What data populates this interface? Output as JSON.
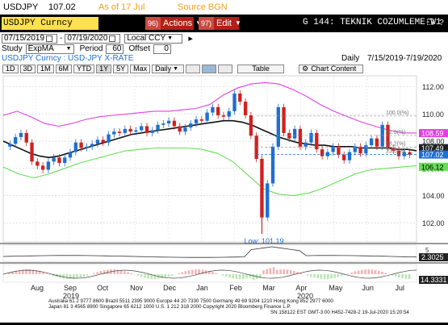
{
  "header": {
    "ticker": "USDJPY",
    "price": "107.02",
    "as_of": "As of 17 Jul",
    "source": "Source BGN"
  },
  "command_bar": {
    "security": "USDJPY Curncy",
    "actions_num": "96)",
    "actions_label": "Actions",
    "edit_num": "97)",
    "edit_label": "Edit",
    "function_title": "G 144: TEKNIK COZUMLEME-W1"
  },
  "controls": {
    "start_date": "07/15/2019",
    "end_date": "07/19/2020",
    "currency": "Local CCY",
    "study_label": "Study",
    "study_value": "ExpMA",
    "period_label": "Period",
    "period_value": "60",
    "offset_label": "Offset",
    "offset_value": "0",
    "subtitle": "USDJPY Curncy : USD-JPY X-RATE",
    "frequency": "Daily",
    "date_range": "7/15/2019-7/19/2020"
  },
  "tabs": {
    "periods": [
      "1D",
      "3D",
      "1M",
      "6M",
      "YTD",
      "1Y",
      "5Y",
      "Max"
    ],
    "active_period": "1Y",
    "freq_select": "Daily",
    "table_label": "Table",
    "chart_content_label": "Chart Content"
  },
  "chart_data": {
    "type": "line",
    "instrument": "USDJPY",
    "x_months": [
      "Aug",
      "Sep",
      "Oct",
      "Nov",
      "Dec",
      "Jan",
      "Feb",
      "Mar",
      "Apr",
      "May",
      "Jun",
      "Jul"
    ],
    "x_years": [
      "2019",
      "2020"
    ],
    "y_ticks": [
      102.0,
      104.0,
      106.0,
      108.0,
      110.0,
      112.0
    ],
    "ylim": [
      100.6,
      112.8
    ],
    "candles_close": [
      107.8,
      108.3,
      108.6,
      107.9,
      106.5,
      106.2,
      105.9,
      106.5,
      106.8,
      106.4,
      106.8,
      107.2,
      107.9,
      107.5,
      107.6,
      107.8,
      108.1,
      107.9,
      108.5,
      108.7,
      108.6,
      108.9,
      108.7,
      108.8,
      109.1,
      108.6,
      108.8,
      109.2,
      109.3,
      109.5,
      109.1,
      108.7,
      109.0,
      109.3,
      109.6,
      109.5,
      110.1,
      110.5,
      109.9,
      109.8,
      110.2,
      111.5,
      110.9,
      109.9,
      108.4,
      106.7,
      102.4,
      104.9,
      107.6,
      110.5,
      108.6,
      108.2,
      108.9,
      107.6,
      107.9,
      108.6,
      107.4,
      106.9,
      107.2,
      107.6,
      107.0,
      106.6,
      107.2,
      107.6,
      107.1,
      107.7,
      108.2,
      107.6,
      109.2,
      107.5,
      107.3,
      106.9,
      107.2,
      107.0
    ],
    "ema60": [
      108.0,
      107.7,
      107.4,
      107.1,
      106.9,
      106.8,
      106.9,
      107.1,
      107.3,
      107.5,
      107.7,
      107.9,
      108.1,
      108.3,
      108.5,
      108.6,
      108.7,
      108.8,
      108.9,
      109.0,
      109.1,
      109.2,
      109.3,
      109.4,
      109.5,
      109.5,
      109.4,
      109.2,
      108.9,
      108.6,
      108.3,
      108.1,
      107.9,
      107.8,
      107.7,
      107.7,
      107.6,
      107.6,
      107.6,
      107.5,
      107.5,
      107.5,
      107.5,
      107.4,
      107.4,
      107.3
    ],
    "upper_band": [
      109.9,
      110.2,
      109.8,
      109.3,
      109.1,
      109.3,
      109.6,
      109.8,
      109.9,
      110.0,
      110.1,
      110.2,
      110.2,
      110.3,
      110.4,
      110.7,
      111.4,
      111.9,
      112.2,
      112.3,
      112.2,
      111.8,
      111.3,
      110.7,
      110.2,
      109.8,
      109.4,
      109.1,
      108.8,
      108.6,
      108.6
    ],
    "lower_band": [
      106.1,
      105.6,
      105.3,
      105.6,
      106.0,
      106.4,
      106.7,
      107.0,
      107.3,
      107.4,
      107.5,
      107.5,
      107.5,
      107.4,
      107.1,
      106.5,
      105.5,
      104.5,
      104.1,
      104.0,
      104.2,
      104.6,
      105.1,
      105.6,
      105.9,
      106.0,
      106.1,
      106.2
    ],
    "fib_levels": [
      {
        "label": "100.0(%)",
        "value": 109.85
      },
      {
        "label": "61.8(%)",
        "value": 108.42
      },
      {
        "label": "38.2(%)",
        "value": 107.55
      },
      {
        "label": "23.6(%)",
        "value": 107.02
      }
    ],
    "low_label": "Low: 101.19",
    "low_value": 101.19,
    "right_labels": [
      {
        "value": "108.59",
        "color": "#e040e0"
      },
      {
        "value": "107.49",
        "color": "#222222"
      },
      {
        "value": "107.02",
        "color": "#1e6fd0"
      },
      {
        "value": "106.12",
        "color": "#66dd55"
      }
    ],
    "panel2": {
      "value": "2.3025",
      "hline": "5"
    },
    "panel3": {
      "value": "14.3331"
    },
    "footer_line1": "Australia 61 2 9777 8600 Brazil 5511 2395 9000 Europe 44 20 7330 7500 Germany 49 69 9204 1210 Hong Kong 852 2977 6000",
    "footer_line2": "Japan 81 3 4565 8900   Singapore 65 6212 1000   U.S. 1 212 318 2000   Copyright 2020 Bloomberg Finance L.P.",
    "footer_line3": "SN 158122 EST GMT-3:00 H452-7428-2 19-Jul-2020 15:20:54"
  },
  "colors": {
    "candle_up": "#1e6fd0",
    "candle_down": "#d02020",
    "ema": "#111111",
    "upper": "#e040e0",
    "lower": "#66dd55"
  }
}
